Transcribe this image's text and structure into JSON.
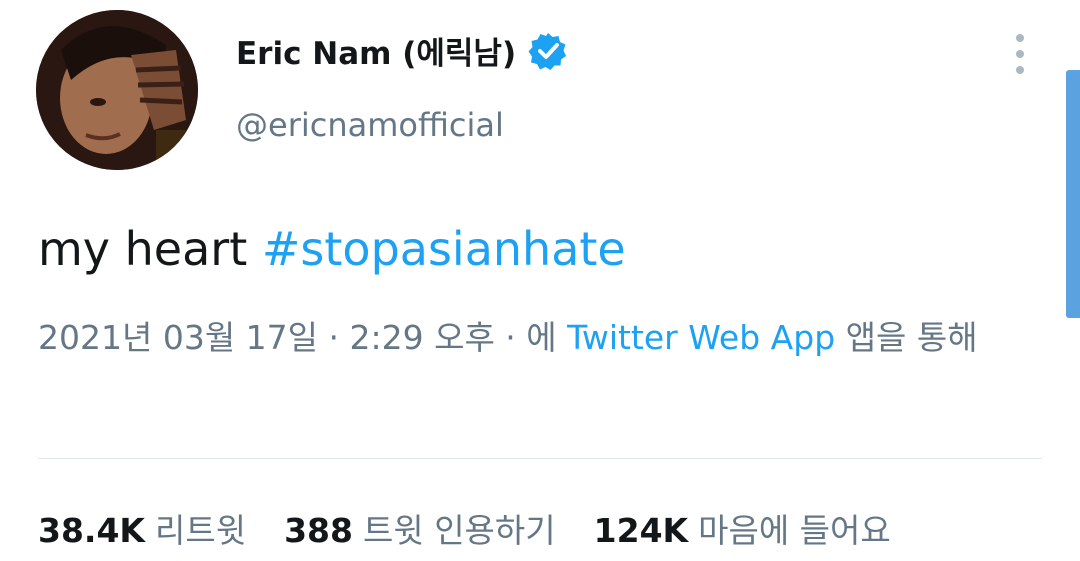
{
  "tweet": {
    "display_name": "Eric Nam (에릭남)",
    "handle": "@ericnamofficial",
    "text_plain": "my heart ",
    "hashtag": "#stopasianhate",
    "timestamp": "2021년 03월 17일 · 2:29 오후 · 에",
    "client": "Twitter Web App",
    "client_suffix": "앱을 통해"
  },
  "stats": {
    "retweets_count": "38.4K",
    "retweets_label": "리트윗",
    "quotes_count": "388",
    "quotes_label": "트윗 인용하기",
    "likes_count": "124K",
    "likes_label": "마음에 들어요"
  },
  "colors": {
    "link": "#1da1f2",
    "secondary_text": "#657786",
    "primary_text": "#14171a"
  },
  "icons": {
    "verified": "verified-badge-icon",
    "more": "more-vertical-icon"
  }
}
